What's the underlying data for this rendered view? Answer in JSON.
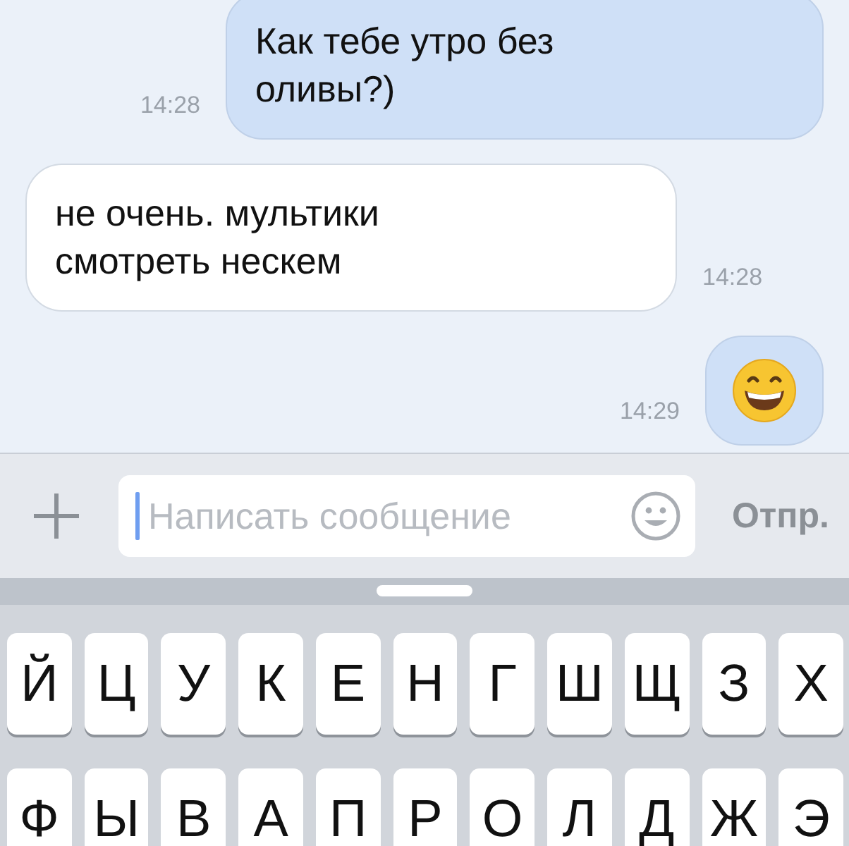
{
  "messages": [
    {
      "outgoing": true,
      "kind": "text",
      "text": "Как тебе утро без оливы?)",
      "time": "14:28"
    },
    {
      "outgoing": false,
      "kind": "text",
      "text": "не очень. мультики смотреть нескем",
      "time": "14:28"
    },
    {
      "outgoing": true,
      "kind": "emoji",
      "time": "14:29"
    }
  ],
  "composer": {
    "placeholder": "Написать сообщение",
    "send": "Отпр."
  },
  "keyboard": {
    "rows": [
      [
        "Й",
        "Ц",
        "У",
        "К",
        "Е",
        "Н",
        "Г",
        "Ш",
        "Щ",
        "З",
        "Х"
      ],
      [
        "Ф",
        "Ы",
        "В",
        "А",
        "П",
        "Р",
        "О",
        "Л",
        "Д",
        "Ж",
        "Э"
      ]
    ]
  }
}
